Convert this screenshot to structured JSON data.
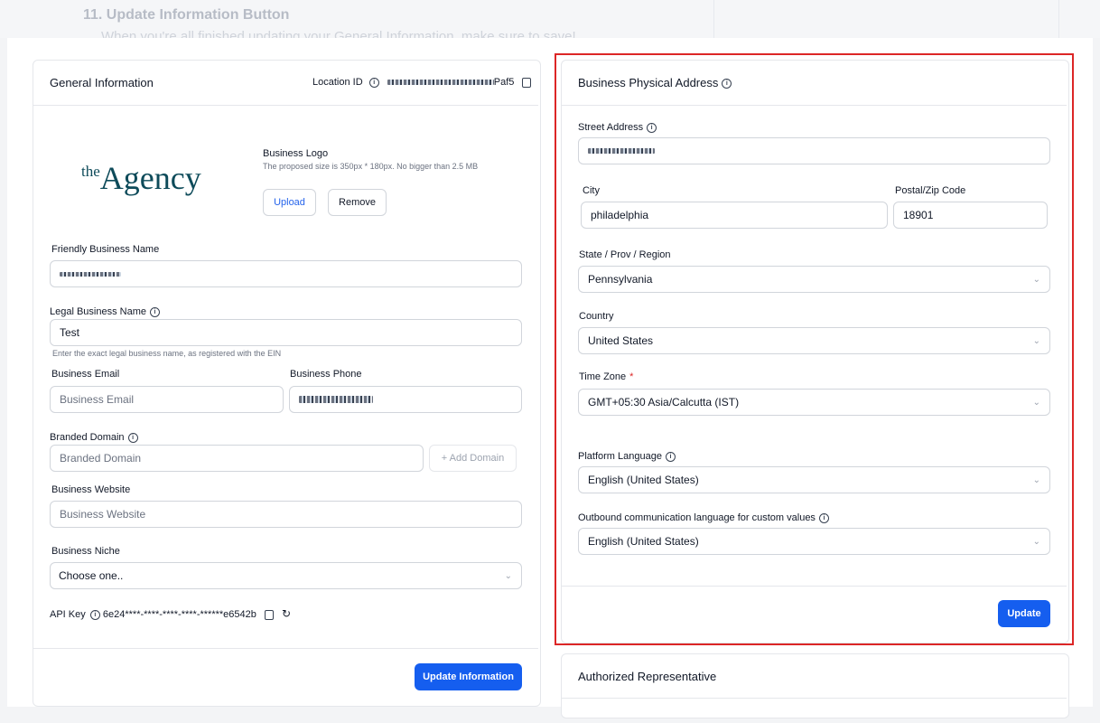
{
  "doc": {
    "step_heading": "11. Update Information Button",
    "step_text": "When you're all finished updating your General Information, make sure to save!"
  },
  "general": {
    "title": "General Information",
    "location_label": "Location ID",
    "location_suffix": "Paf5",
    "logo_text_small": "the",
    "logo_text_big": "Agency",
    "logo_label": "Business Logo",
    "logo_help": "The proposed size is 350px * 180px. No bigger than 2.5 MB",
    "upload_label": "Upload",
    "remove_label": "Remove",
    "friendly_label": "Friendly Business Name",
    "legal_label": "Legal Business Name",
    "legal_value": "Test",
    "legal_help": "Enter the exact legal business name, as registered with the EIN",
    "email_label": "Business Email",
    "email_placeholder": "Business Email",
    "phone_label": "Business Phone",
    "domain_label": "Branded Domain",
    "domain_placeholder": "Branded Domain",
    "add_domain_label": "+ Add Domain",
    "website_label": "Business Website",
    "website_placeholder": "Business Website",
    "niche_label": "Business Niche",
    "niche_value": "Choose one..",
    "api_label": "API Key",
    "api_value": "6e24****-****-****-****-******e6542b",
    "update_info_label": "Update Information"
  },
  "address": {
    "title": "Business Physical Address",
    "street_label": "Street Address",
    "city_label": "City",
    "city_value": "philadelphia",
    "zip_label": "Postal/Zip Code",
    "zip_value": "18901",
    "state_label": "State / Prov / Region",
    "state_value": "Pennsylvania",
    "country_label": "Country",
    "country_value": "United States",
    "timezone_label": "Time Zone",
    "timezone_required": "*",
    "timezone_value": "GMT+05:30 Asia/Calcutta (IST)",
    "platform_lang_label": "Platform Language",
    "platform_lang_value": "English (United States)",
    "outbound_lang_label": "Outbound communication language for custom values",
    "outbound_lang_value": "English (United States)",
    "update_label": "Update"
  },
  "authorized": {
    "title": "Authorized Representative"
  },
  "icons": {
    "info": "info-circle-icon",
    "copy": "copy-icon",
    "refresh": "refresh-icon",
    "chevron": "chevron-down-icon"
  },
  "colors": {
    "primary": "#155eef",
    "highlight": "#dc2626",
    "logo": "#0e4b5a"
  }
}
